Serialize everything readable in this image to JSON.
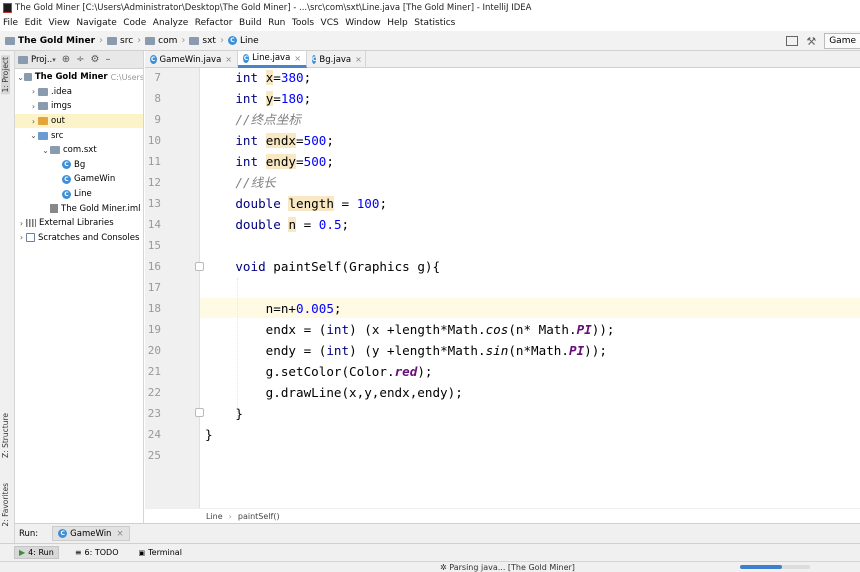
{
  "window": {
    "title": "The Gold Miner [C:\\Users\\Administrator\\Desktop\\The Gold Miner] - ...\\src\\com\\sxt\\Line.java [The Gold Miner] - IntelliJ IDEA"
  },
  "menu": [
    "File",
    "Edit",
    "View",
    "Navigate",
    "Code",
    "Analyze",
    "Refactor",
    "Build",
    "Run",
    "Tools",
    "VCS",
    "Window",
    "Help",
    "Statistics"
  ],
  "nav": {
    "crumbs": [
      "The Gold Miner",
      "src",
      "com",
      "sxt",
      "Line"
    ],
    "run_config": "Game"
  },
  "left_stripe": {
    "project": "1: Project",
    "structure": "Z: Structure",
    "favorites": "2: Favorites"
  },
  "project_panel": {
    "header": "Proj..",
    "tree": [
      {
        "label": "The Gold Miner",
        "extra": "C:\\Users",
        "type": "folder",
        "level": 0,
        "arrow": "v",
        "bold": true
      },
      {
        "label": ".idea",
        "type": "folder",
        "level": 1,
        "arrow": ">"
      },
      {
        "label": "imgs",
        "type": "folder",
        "level": 1,
        "arrow": ">"
      },
      {
        "label": "out",
        "type": "folder-orange",
        "level": 1,
        "arrow": ">",
        "selected": true
      },
      {
        "label": "src",
        "type": "folder-blue",
        "level": 1,
        "arrow": "v"
      },
      {
        "label": "com.sxt",
        "type": "package",
        "level": 2,
        "arrow": "v"
      },
      {
        "label": "Bg",
        "type": "class",
        "level": 3
      },
      {
        "label": "GameWin",
        "type": "class",
        "level": 3
      },
      {
        "label": "Line",
        "type": "class",
        "level": 3
      },
      {
        "label": "The Gold Miner.iml",
        "type": "iml",
        "level": 2
      },
      {
        "label": "External Libraries",
        "type": "lib",
        "level": 0,
        "arrow": ">"
      },
      {
        "label": "Scratches and Consoles",
        "type": "scratch",
        "level": 0,
        "arrow": ">"
      }
    ]
  },
  "tabs": [
    {
      "label": "GameWin.java",
      "active": false
    },
    {
      "label": "Line.java",
      "active": true
    },
    {
      "label": "Bg.java",
      "active": false
    }
  ],
  "editor": {
    "line_numbers": [
      "7",
      "8",
      "9",
      "10",
      "11",
      "12",
      "13",
      "14",
      "15",
      "16",
      "17",
      "18",
      "19",
      "20",
      "21",
      "22",
      "23",
      "24",
      "25"
    ],
    "current_line": "18"
  },
  "code_breadcrumb": [
    "Line",
    "paintSelf()"
  ],
  "run_bar": {
    "label": "Run:",
    "tab": "GameWin"
  },
  "bottom_tabs": [
    {
      "label": "4: Run",
      "icon": "play-icon",
      "active": true
    },
    {
      "label": "6: TODO",
      "icon": "list-icon",
      "active": false
    },
    {
      "label": "Terminal",
      "icon": "terminal-icon",
      "active": false
    }
  ],
  "status": {
    "text": "Parsing java... [The Gold Miner]",
    "progress": 0.6
  },
  "colors": {
    "keyword": "#000080",
    "number": "#0000ff",
    "comment": "#808080",
    "field": "#660e7a",
    "selection_accent": "#4a86c7"
  }
}
